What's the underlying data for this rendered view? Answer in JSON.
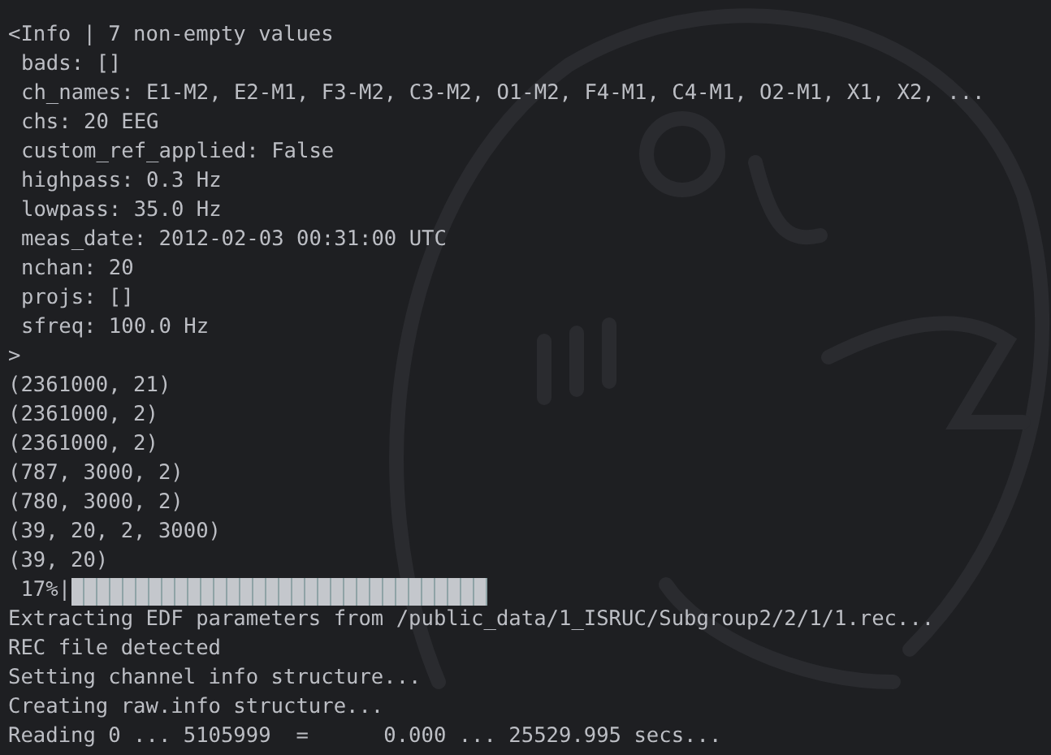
{
  "info_header": "<Info | 7 non-empty values",
  "info_fields": [
    "bads: []",
    "ch_names: E1-M2, E2-M1, F3-M2, C3-M2, O1-M2, F4-M1, C4-M1, O2-M1, X1, X2, ...",
    "chs: 20 EEG",
    "custom_ref_applied: False",
    "highpass: 0.3 Hz",
    "lowpass: 35.0 Hz",
    "meas_date: 2012-02-03 00:31:00 UTC",
    "nchan: 20",
    "projs: []",
    "sfreq: 100.0 Hz"
  ],
  "info_footer": ">",
  "shapes": [
    "(2361000, 21)",
    "(2361000, 2)",
    "(2361000, 2)",
    "(787, 3000, 2)",
    "(780, 3000, 2)",
    "(39, 20, 2, 3000)",
    "(39, 20)"
  ],
  "progress": {
    "percent": " 17%|"
  },
  "log_lines": [
    "Extracting EDF parameters from /public_data/1_ISRUC/Subgroup2/2/1/1.rec...",
    "REC file detected",
    "Setting channel info structure...",
    "Creating raw.info structure...",
    "Reading 0 ... 5105999  =      0.000 ... 25529.995 secs..."
  ]
}
